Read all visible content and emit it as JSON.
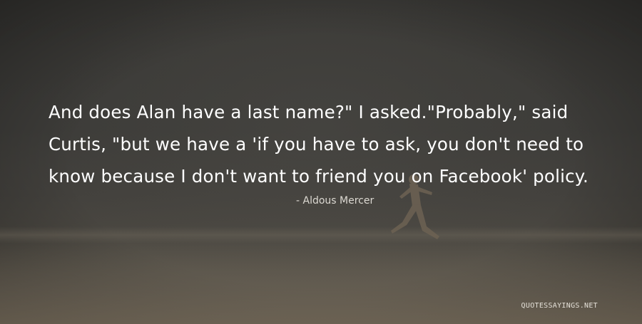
{
  "quote": {
    "text": "And does Alan have a last name?\" I asked.\"Probably,\" said Curtis, \"but we have a 'if you have to ask, you don't need to know because I don't want to friend you on Facebook' policy.",
    "author": "- Aldous Mercer"
  },
  "watermark": "QUOTESSAYINGS.NET",
  "photo": {
    "subject": "person leaping on a beach at dusk"
  },
  "colors": {
    "sky": "#3c3b38",
    "sand": "#635d52",
    "text": "#ffffff"
  }
}
